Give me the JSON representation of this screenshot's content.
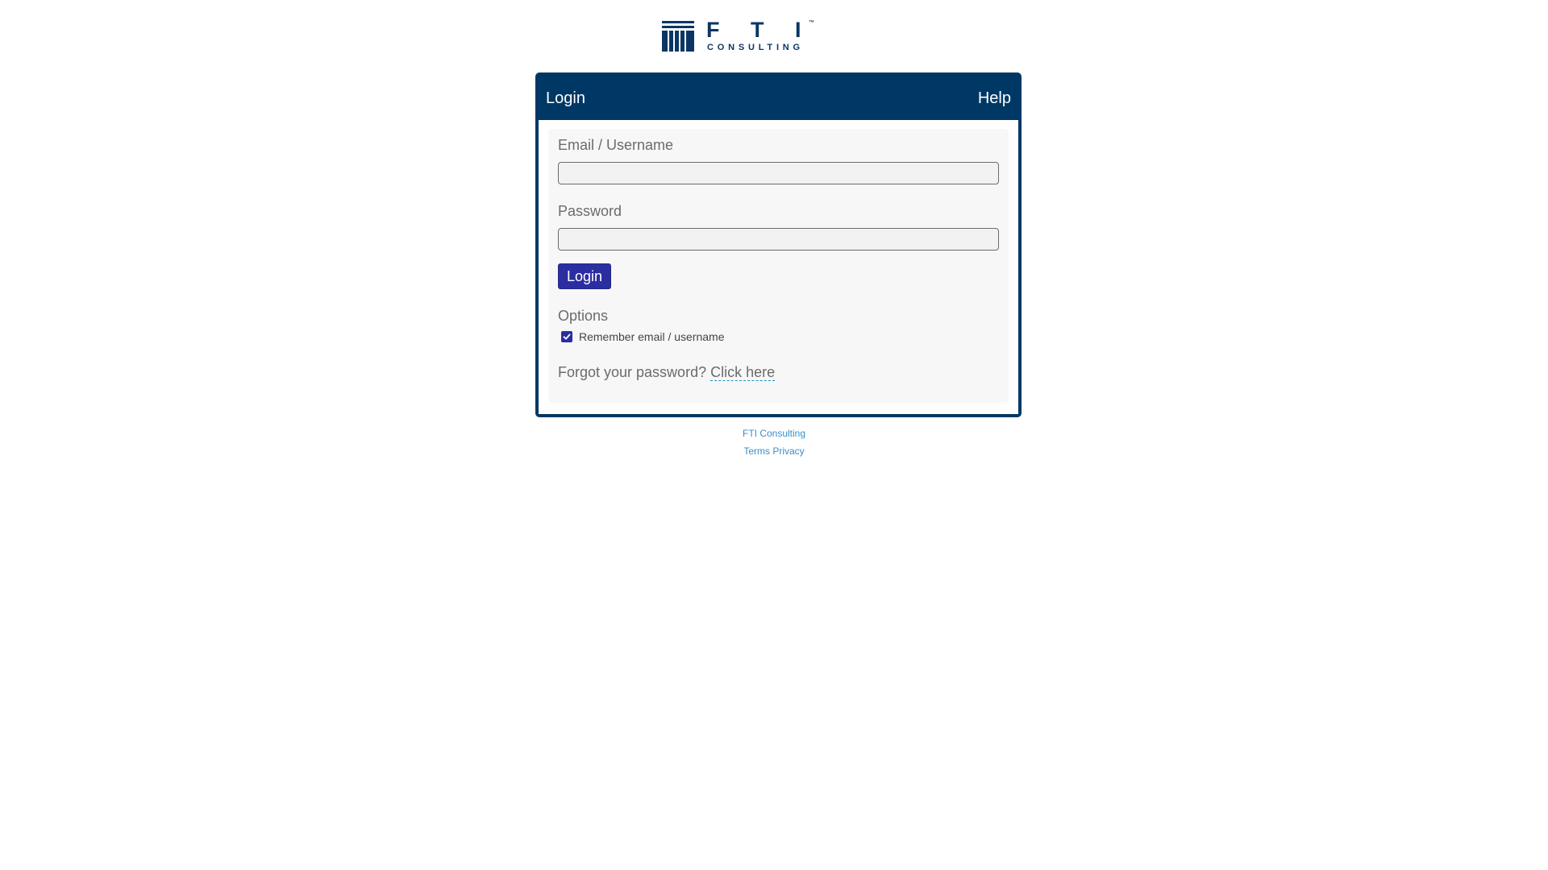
{
  "brand": {
    "letters": [
      "F",
      "T",
      "I"
    ],
    "trademark": "™",
    "subtitle": "CONSULTING",
    "color": "#0b3664"
  },
  "panel": {
    "title": "Login",
    "help_label": "Help",
    "header_color": "#003865"
  },
  "form": {
    "email_label": "Email / Username",
    "email_value": "",
    "password_label": "Password",
    "password_value": "",
    "submit_label": "Login",
    "options_label": "Options",
    "remember_label": "Remember email / username",
    "remember_checked": true,
    "forgot_text": "Forgot your password?",
    "forgot_link": "Click here",
    "button_color": "#2b2ea0"
  },
  "footer": {
    "company_link": "FTI Consulting",
    "terms_link": "Terms",
    "privacy_link": "Privacy",
    "link_color": "#3a8fc9"
  },
  "icons": {
    "logo_mark": "columns-logo-icon",
    "checkbox": "check-icon"
  }
}
